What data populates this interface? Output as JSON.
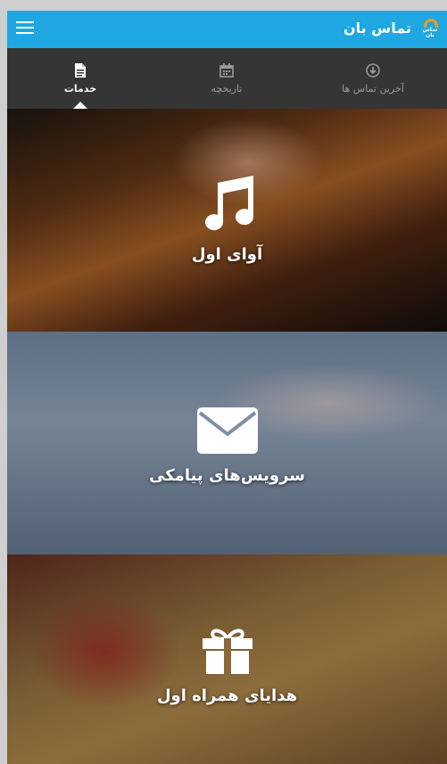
{
  "header": {
    "app_title": "تماس بان",
    "logo_text": "تماس بان",
    "menu_icon": "hamburger-menu-icon",
    "color": "#1ea7e1",
    "logo_color": "#f39a1b"
  },
  "tabs": [
    {
      "label": "خدمات",
      "icon": "document-icon",
      "active": true
    },
    {
      "label": "تاریخچه",
      "icon": "calendar-icon",
      "active": false
    },
    {
      "label": "آخرین تماس ها",
      "icon": "download-circle-icon",
      "active": false
    }
  ],
  "cards": [
    {
      "title": "آوای اول",
      "icon": "music-note-icon"
    },
    {
      "title": "سرویس‌های پیامکی",
      "icon": "envelope-icon"
    },
    {
      "title": "هدایای همراه اول",
      "icon": "gift-icon"
    }
  ],
  "colors": {
    "tabbar_bg": "#353535",
    "tab_inactive": "#9a9a9a",
    "tab_active": "#ffffff"
  }
}
